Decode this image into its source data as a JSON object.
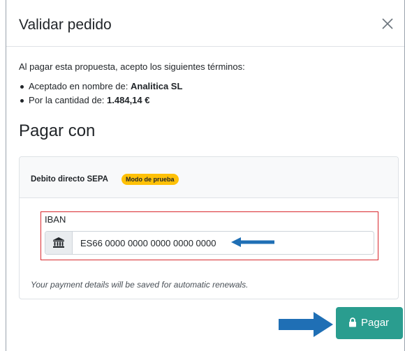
{
  "modal": {
    "title": "Validar pedido",
    "close_icon": "close-icon"
  },
  "terms": {
    "intro": "Al pagar esta propuesta, acepto los siguientes términos:",
    "accepted_prefix": "Aceptado en nombre de: ",
    "accepted_value": "Analitica SL",
    "amount_prefix": "Por la cantidad de: ",
    "amount_value": "1.484,14 €"
  },
  "pay_with": {
    "heading": "Pagar con",
    "method_label": "Debito directo SEPA",
    "test_badge": "Modo de prueba",
    "iban_label": "IBAN",
    "iban_value": "ES66 0000 0000 0000 0000 0000",
    "bank_icon": "bank-icon",
    "save_note": "Your payment details will be saved for automatic renewals."
  },
  "footer": {
    "pay_button": "Pagar",
    "lock_icon": "lock-icon"
  },
  "colors": {
    "accent": "#2a9d8f",
    "badge": "#ffc107",
    "highlight_border": "#d9292e",
    "annotation_arrow": "#1f6fb5"
  }
}
